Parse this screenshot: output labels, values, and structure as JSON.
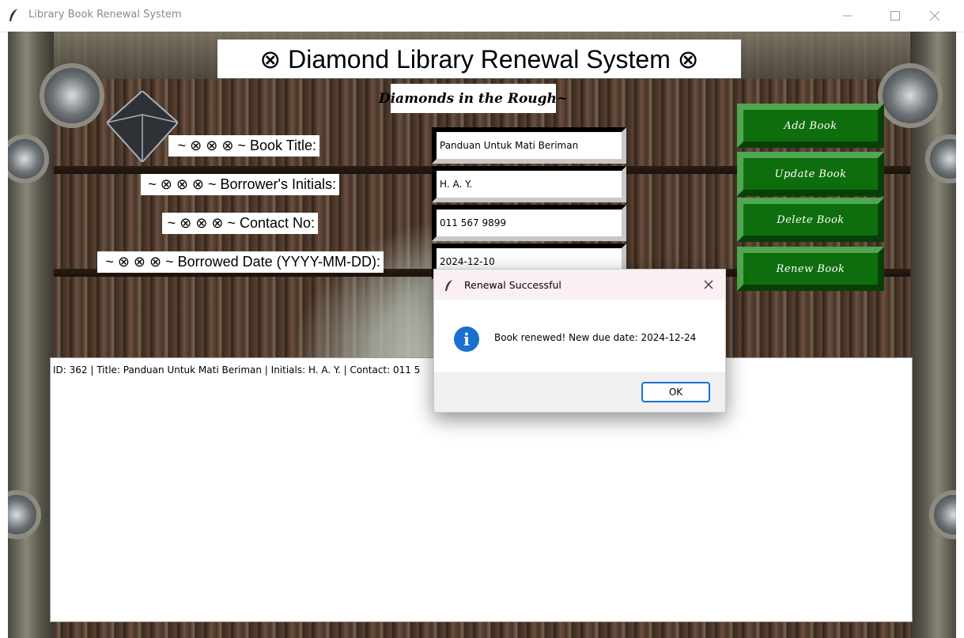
{
  "window": {
    "title": "Library Book Renewal System"
  },
  "header": {
    "title": "⊗ Diamond Library Renewal System ⊗",
    "subtitle": "Diamonds in the Rough~"
  },
  "form": {
    "fields": [
      {
        "label": "~ ⊗ ⊗ ⊗ ~ Book Title:",
        "value": "Panduan Untuk Mati Beriman"
      },
      {
        "label": "~ ⊗ ⊗ ⊗ ~ Borrower's Initials:",
        "value": "H. A. Y."
      },
      {
        "label": "~ ⊗ ⊗ ⊗ ~ Contact No:",
        "value": "011 567 9899"
      },
      {
        "label": "~ ⊗ ⊗ ⊗ ~ Borrowed Date (YYYY-MM-DD):",
        "value": "2024-12-10"
      }
    ]
  },
  "actions": {
    "add": "Add Book",
    "update": "Update Book",
    "delete": "Delete Book",
    "renew": "Renew Book"
  },
  "records": {
    "rows": [
      "ID: 362 | Title: Panduan Untuk Mati Beriman | Initials: H. A. Y. | Contact: 011 5"
    ]
  },
  "dialog": {
    "title": "Renewal Successful",
    "message": "Book renewed! New due date: 2024-12-24",
    "ok_label": "OK"
  },
  "colors": {
    "button_green": "#0e6e0e",
    "info_blue": "#1a6fd1"
  }
}
